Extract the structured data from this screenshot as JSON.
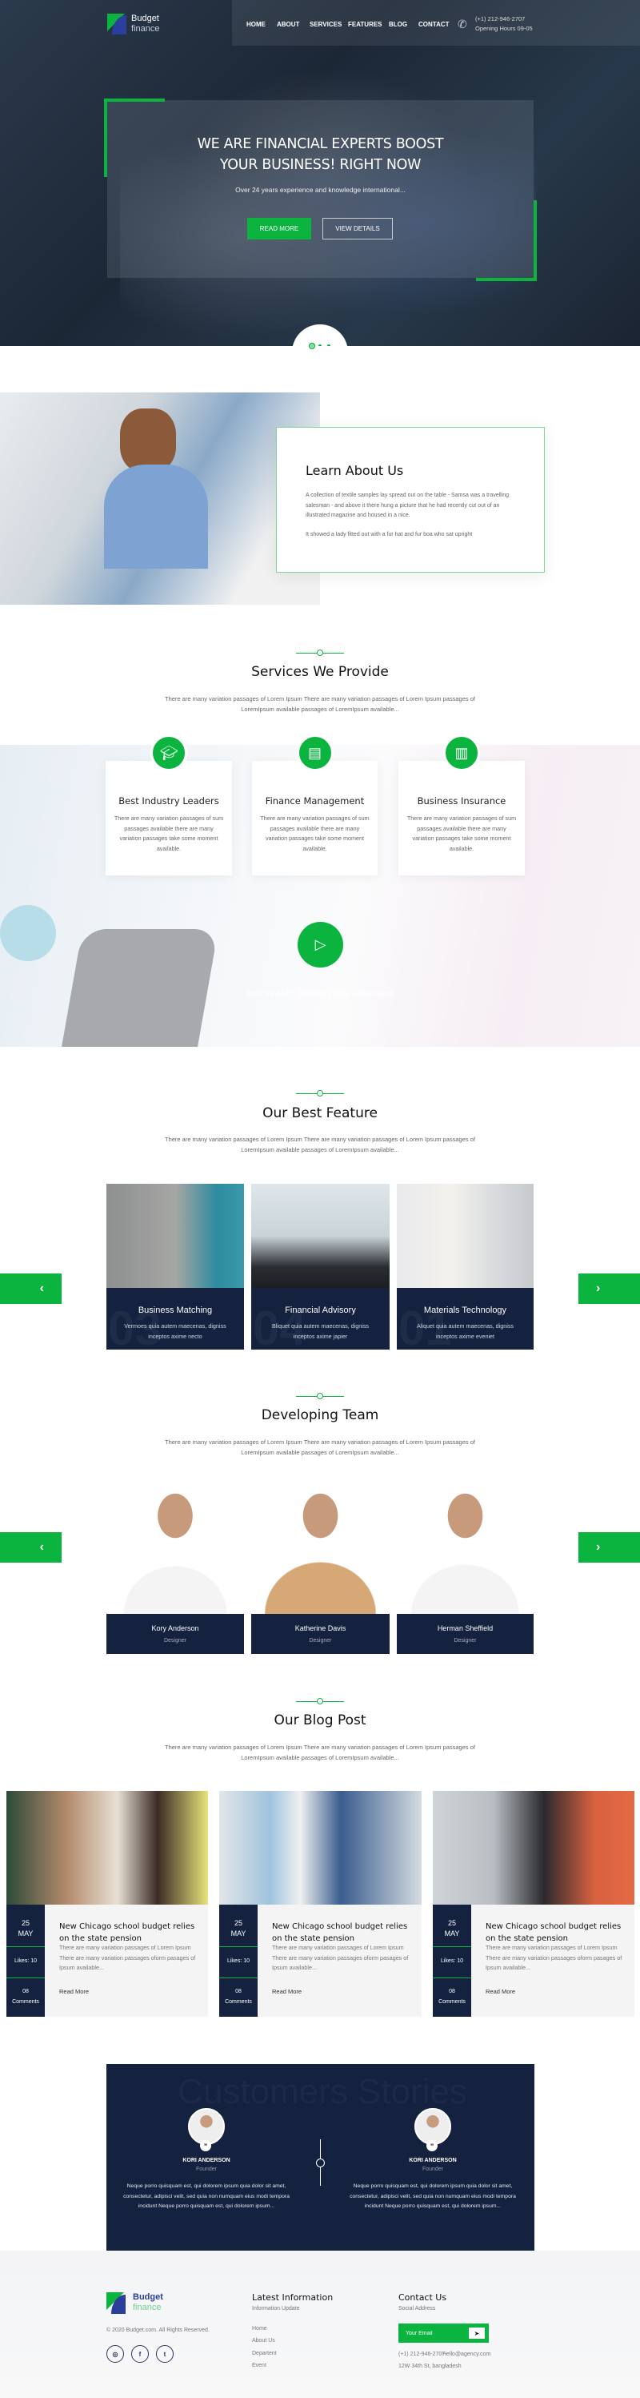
{
  "header": {
    "logo": {
      "line1": "Budget",
      "line2": "finance"
    },
    "nav": [
      "HOME",
      "ABOUT",
      "SERVICES",
      "FEATURES",
      "BLOG",
      "CONTACT"
    ],
    "phone": "(+1) 212-946-2707",
    "hours": "Opening Hours 09-05"
  },
  "hero": {
    "title_line1": "WE ARE FINANCIAL EXPERTS BOOST",
    "title_line2": "YOUR BUSINESS! RIGHT NOW",
    "subtitle": "Over 24 years experience and knowledge international...",
    "read_more": "READ MORE",
    "view_details": "VIEW DETAILS",
    "slide_count": 3,
    "active_slide": 1
  },
  "about": {
    "title": "Learn About Us",
    "para1": "A collection of textile samples lay spread out on the table - Samsa was a travelling salesman - and above it there hung a picture that he had recently cut out of an illustrated magazine and housed in a nice.",
    "para2": "It showed a lady fitted out with a fur hat and fur boa who sat upright"
  },
  "services": {
    "title": "Services We Provide",
    "subtitle": "There are many variation passages of Lorem Ipsum There are many variation passages of Lorem Ipsum passages of LoremIpsum available passages of LoremIpsum available...",
    "items": [
      {
        "icon": "graduation-cap-icon",
        "title": "Best Industry Leaders",
        "text": "There are many variation passages of sum passages available there are many variation passages take some moment available."
      },
      {
        "icon": "book-icon",
        "title": "Finance Management",
        "text": "There are many variation passages of sum passages available there are many variation passages take some moment available."
      },
      {
        "icon": "binders-icon",
        "title": "Business Insurance",
        "text": "There are many variation passages of sum passages available there are many variation passages take some moment available."
      }
    ],
    "video_caption": "Just as AMC Theaters took advantage"
  },
  "features": {
    "title": "Our Best Feature",
    "subtitle": "There are many variation passages of Lorem Ipsum There are many variation passages of Lorem Ipsum passages of LoremIpsum available passages of LoremIpsum available...",
    "items": [
      {
        "num": "03",
        "title": "Business Matching",
        "text": "Vermoes quia autem maecenas, digniss inceptos axime necto"
      },
      {
        "num": "04",
        "title": "Financial Advisory",
        "text": "Bliquet quia autem maecenas, digniss inceptos axime japier"
      },
      {
        "num": "01",
        "title": "Materials Technology",
        "text": "Aliquet quia autem maecenas, digniss inceptos axime eveniet"
      }
    ]
  },
  "team": {
    "title": "Developing Team",
    "subtitle": "There are many variation passages of Lorem Ipsum There are many variation passages of Lorem Ipsum passages of LoremIpsum available passages of LoremIpsum available...",
    "members": [
      {
        "name": "Kory Anderson",
        "role": "Designer"
      },
      {
        "name": "Katherine Davis",
        "role": "Designer"
      },
      {
        "name": "Herman Sheffield",
        "role": "Designer"
      }
    ]
  },
  "blog": {
    "title": "Our Blog Post",
    "subtitle": "There are many variation passages of Lorem Ipsum There are many variation passages of Lorem Ipsum passages of LoremIpsum available passages of LoremIpsum available...",
    "posts": [
      {
        "day": "25",
        "month": "MAY",
        "likes": "Likes: 10",
        "comments_count": "08",
        "comments_label": "Comments",
        "title": "New Chicago school budget relies on the state pension",
        "excerpt": "There are many variation passages of Lorem Ipsum There are many variation passages oform pasages of Ipsum available...",
        "link": "Read More"
      },
      {
        "day": "25",
        "month": "MAY",
        "likes": "Likes: 10",
        "comments_count": "08",
        "comments_label": "Comments",
        "title": "New Chicago school budget relies on the state pension",
        "excerpt": "There are many variation passages of Lorem Ipsum There are many variation passages oform pasages of Ipsum available...",
        "link": "Read More"
      },
      {
        "day": "25",
        "month": "MAY",
        "likes": "Likes: 10",
        "comments_count": "08",
        "comments_label": "Comments",
        "title": "New Chicago school budget relies on the state pension",
        "excerpt": "There are many variation passages of Lorem Ipsum There are many variation passages oform pasages of Ipsum available...",
        "link": "Read More"
      }
    ]
  },
  "testimonials": {
    "watermark": "Customers Stories",
    "items": [
      {
        "name": "KORI ANDERSON",
        "role": "Founder",
        "text": "Neque porro quisquam est, qui dolorem ipsum quia dolor sit amet, consectetur, adipisci velit, sed quia non numquam eius modi tempora incidunt Neque porro quisquam est, qui dolorem ipsum..."
      },
      {
        "name": "KORI ANDERSON",
        "role": "Founder",
        "text": "Neque porro quisquam est, qui dolorem ipsum quia dolor sit amet, consectetur, adipisci velit, sed quia non numquam eius modi tempora incidunt Neque porro quisquam est, qui dolorem ipsum..."
      }
    ]
  },
  "footer": {
    "logo": {
      "line1": "Budget",
      "line2": "finance"
    },
    "copyright": "© 2020 Budget.com. All Rights Reserved.",
    "social": [
      "instagram-icon",
      "facebook-icon",
      "twitter-icon"
    ],
    "latest": {
      "title": "Latest Information",
      "subtitle": "Information Update",
      "links": [
        "Home",
        "About Us",
        "Departent",
        "Event"
      ]
    },
    "contact": {
      "title": "Contact Us",
      "subtitle": "Social Address",
      "email_placeholder": "Your Email",
      "phone": "(+1) 212-946-2707",
      "email": "Hello@agency.com",
      "address": "12W 34th St, bangladesh"
    }
  },
  "colors": {
    "accent": "#0bb33f",
    "navy": "#14213f",
    "logo_blue": "#2c3e9c"
  }
}
